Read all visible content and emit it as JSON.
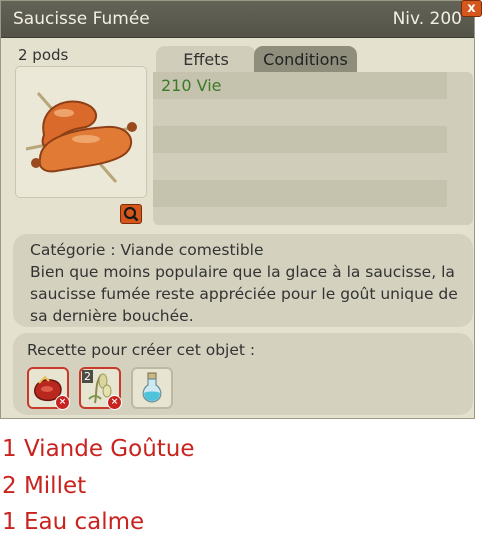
{
  "window": {
    "title": "Saucisse Fumée",
    "level": "Niv. 200",
    "close_glyph": "x"
  },
  "item": {
    "pods": "2 pods",
    "icon": "smoked-sausage-icon"
  },
  "tabs": [
    {
      "label": "Effets",
      "active": true
    },
    {
      "label": "Conditions",
      "active": false
    }
  ],
  "effects": [
    "210 Vie"
  ],
  "description": {
    "category": "Catégorie : Viande comestible",
    "text": "Bien que moins populaire que la glace à la saucisse, la saucisse fumée reste appréciée pour le goût unique de sa dernière bouchée."
  },
  "recipe": {
    "label": "Recette pour créer cet objet :",
    "ingredients": [
      {
        "icon": "meat-icon",
        "quantity": "",
        "missing": true
      },
      {
        "icon": "millet-icon",
        "quantity": "2",
        "missing": true
      },
      {
        "icon": "water-vial-icon",
        "quantity": "",
        "missing": false
      }
    ]
  },
  "annotations": [
    "1 Viande Goûtue",
    "2 Millet",
    "1 Eau calme"
  ],
  "colors": {
    "title_bar": "#545348",
    "panel": "#e4e1ce",
    "accent_orange": "#d5571b",
    "effect_green": "#3c7a2a",
    "annotation_red": "#c8231e"
  }
}
